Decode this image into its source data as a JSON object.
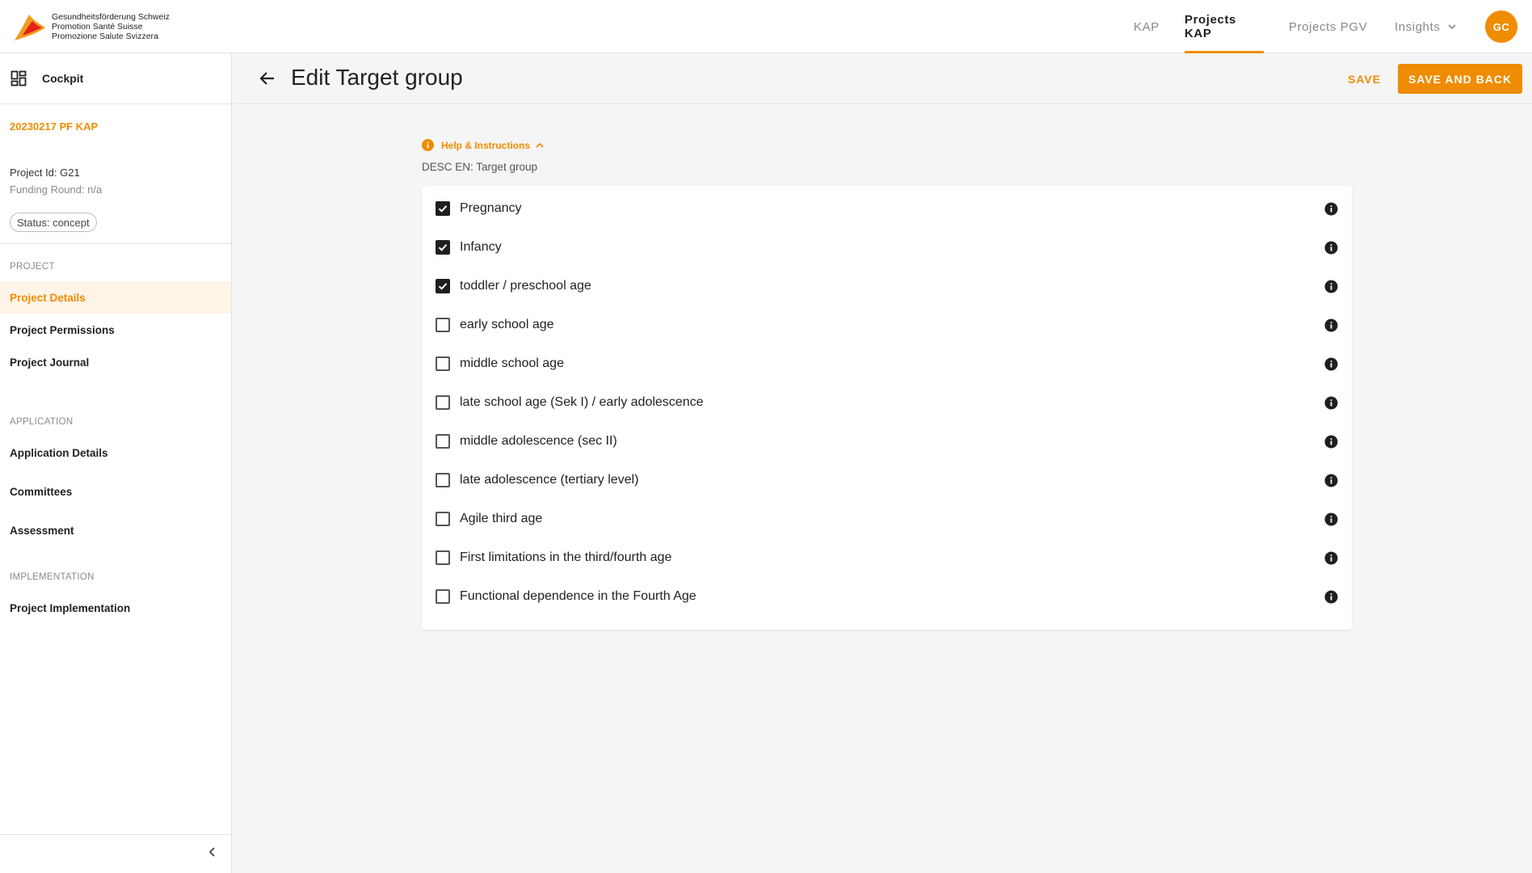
{
  "header": {
    "logo_lines": [
      "Gesundheitsförderung Schweiz",
      "Promotion Santé Suisse",
      "Promozione Salute Svizzera"
    ],
    "nav": [
      {
        "label": "KAP",
        "active": false
      },
      {
        "label": "Projects KAP",
        "active": true
      },
      {
        "label": "Projects PGV",
        "active": false
      },
      {
        "label": "Insights",
        "active": false
      }
    ],
    "avatar_initials": "GC"
  },
  "sidebar": {
    "cockpit_label": "Cockpit",
    "project_name": "20230217 PF KAP",
    "project_id": "Project Id: G21",
    "funding_round": "Funding Round: n/a",
    "status": "Status: concept",
    "sections": [
      {
        "title": "PROJECT",
        "items": [
          "Project Details",
          "Project Permissions",
          "Project Journal"
        ]
      },
      {
        "title": "APPLICATION",
        "items": [
          "Application Details",
          "Committees",
          "Assessment"
        ]
      },
      {
        "title": "IMPLEMENTATION",
        "items": [
          "Project Implementation"
        ]
      }
    ],
    "active_item": "Project Details"
  },
  "page": {
    "title": "Edit Target group",
    "save_label": "SAVE",
    "save_back_label": "SAVE AND BACK",
    "help_label": "Help & Instructions",
    "description": "DESC EN: Target group"
  },
  "target_groups": [
    {
      "label": "Pregnancy",
      "checked": true
    },
    {
      "label": "Infancy",
      "checked": true
    },
    {
      "label": "toddler / preschool age",
      "checked": true
    },
    {
      "label": "early school age",
      "checked": false
    },
    {
      "label": "middle school age",
      "checked": false
    },
    {
      "label": "late school age (Sek I) / early adolescence",
      "checked": false
    },
    {
      "label": "middle adolescence (sec II)",
      "checked": false
    },
    {
      "label": "late adolescence (tertiary level)",
      "checked": false
    },
    {
      "label": "Agile third age",
      "checked": false
    },
    {
      "label": "First limitations in the third/fourth age",
      "checked": false
    },
    {
      "label": "Functional dependence in the Fourth Age",
      "checked": false
    }
  ],
  "colors": {
    "accent": "#f08c00",
    "active_bg": "#fff4e8"
  }
}
